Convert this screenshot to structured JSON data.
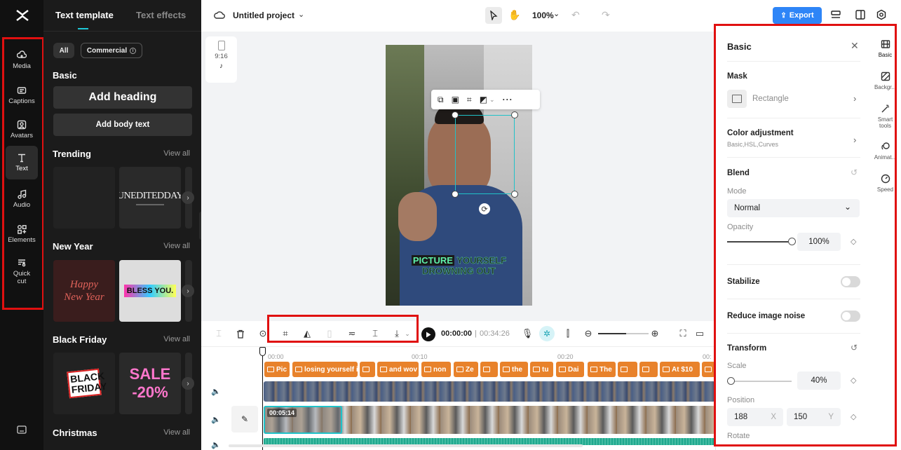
{
  "rail": {
    "items": [
      {
        "label": "Media",
        "icon": "cloud-upload-icon"
      },
      {
        "label": "Captions",
        "icon": "captions-icon"
      },
      {
        "label": "Avatars",
        "icon": "avatar-icon"
      },
      {
        "label": "Text",
        "icon": "text-icon"
      },
      {
        "label": "Audio",
        "icon": "music-note-icon"
      },
      {
        "label": "Elements",
        "icon": "elements-icon"
      },
      {
        "label": "Quick",
        "label2": "cut",
        "icon": "quick-cut-icon"
      }
    ]
  },
  "panel": {
    "tabs": [
      "Text template",
      "Text effects"
    ],
    "filters": {
      "all": "All",
      "commercial": "Commercial"
    },
    "basic": {
      "title": "Basic",
      "add_heading": "Add heading",
      "add_body": "Add body text"
    },
    "view_all": "View all",
    "sections": [
      {
        "title": "Trending",
        "cards": [
          "",
          "UNEDITEDDAY"
        ]
      },
      {
        "title": "New Year",
        "cards": [
          "Happy New Year",
          "BLESS YOU."
        ]
      },
      {
        "title": "Black Friday",
        "cards": [
          "BLACK FRIDAY",
          "SALE -20%"
        ]
      },
      {
        "title": "Christmas"
      }
    ]
  },
  "topbar": {
    "project_name": "Untitled project",
    "zoom": "100%",
    "export": "Export"
  },
  "canvas": {
    "aspect": "9:16",
    "caption_highlight": "PICTURE",
    "caption_rest": "YOURSELF",
    "caption_line2": "DROWNING OUT"
  },
  "timeline": {
    "current_time": "00:00:00",
    "total_time": "00:34:26",
    "ruler": [
      "00:00",
      "00:10",
      "00:20",
      "00:"
    ],
    "clips": [
      "Pic",
      "losing yourself i",
      "",
      "and wov",
      "non",
      "Ze",
      "",
      "the",
      "tu",
      "Dai",
      "The",
      "",
      "",
      "At $10",
      ""
    ],
    "selected_clip_duration": "00:05:14"
  },
  "right_panel": {
    "title": "Basic",
    "mask_label": "Mask",
    "mask_value": "Rectangle",
    "color_adjustment": "Color adjustment",
    "color_adjustment_sub": "Basic,HSL,Curves",
    "blend": "Blend",
    "mode_label": "Mode",
    "mode_value": "Normal",
    "opacity_label": "Opacity",
    "opacity_value": "100%",
    "opacity_fraction": 1.0,
    "stabilize": "Stabilize",
    "reduce_noise": "Reduce image noise",
    "transform": "Transform",
    "scale_label": "Scale",
    "scale_value": "40%",
    "scale_fraction": 0.05,
    "position_label": "Position",
    "position_x": "188",
    "position_x_axis": "X",
    "position_y": "150",
    "position_y_axis": "Y",
    "rotate_label": "Rotate"
  },
  "right_tabs": [
    {
      "label": "Basic",
      "icon": "film-icon"
    },
    {
      "label": "Backgr...",
      "icon": "background-icon"
    },
    {
      "label": "Smart",
      "label2": "tools",
      "icon": "magic-wand-icon"
    },
    {
      "label": "Animat...",
      "icon": "animation-icon"
    },
    {
      "label": "Speed",
      "icon": "speed-icon"
    }
  ],
  "colors": {
    "accent": "#2e85f7",
    "highlight_red": "#e01010",
    "clip_orange": "#e8822b",
    "selection_cyan": "#20c2c8"
  }
}
